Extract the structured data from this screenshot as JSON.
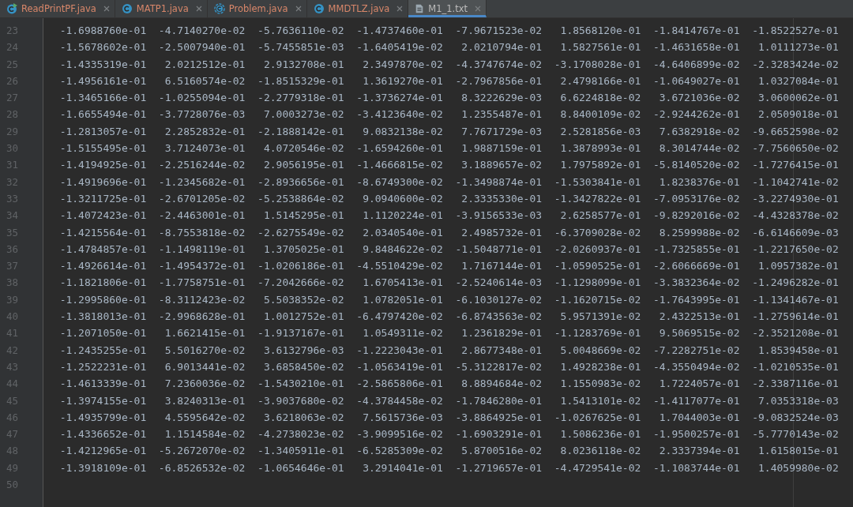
{
  "tabs": [
    {
      "label": "ReadPrintPF.java",
      "kind": "runnable-class",
      "color": "#d9876a",
      "selected": false
    },
    {
      "label": "MATP1.java",
      "kind": "class",
      "color": "#d9876a",
      "selected": false
    },
    {
      "label": "Problem.java",
      "kind": "abstract-class",
      "color": "#d9876a",
      "selected": false
    },
    {
      "label": "MMDTLZ.java",
      "kind": "class",
      "color": "#d9876a",
      "selected": false
    },
    {
      "label": "M1_1.txt",
      "kind": "text",
      "color": "#bbbbbb",
      "selected": true
    }
  ],
  "lines": [
    {
      "number": "23",
      "values": [
        "-1.6988760e-01",
        "-4.7140270e-02",
        "-5.7636110e-02",
        "-1.4737460e-01",
        "-7.9671523e-02",
        "1.8568120e-01",
        "-1.8414767e-01",
        "-1.8522527e-01"
      ]
    },
    {
      "number": "24",
      "values": [
        "-1.5678602e-01",
        "-2.5007940e-01",
        "-5.7455851e-03",
        "-1.6405419e-02",
        "2.0210794e-01",
        "1.5827561e-01",
        "-1.4631658e-01",
        "1.0111273e-01"
      ]
    },
    {
      "number": "25",
      "values": [
        "-1.4335319e-01",
        "2.0212512e-01",
        "2.9132708e-01",
        "2.3497870e-02",
        "-4.3747674e-02",
        "-3.1708028e-01",
        "-4.6406899e-02",
        "-2.3283424e-02"
      ]
    },
    {
      "number": "26",
      "values": [
        "-1.4956161e-01",
        "6.5160574e-02",
        "-1.8515329e-01",
        "1.3619270e-01",
        "-2.7967856e-01",
        "2.4798166e-01",
        "-1.0649027e-01",
        "1.0327084e-01"
      ]
    },
    {
      "number": "27",
      "values": [
        "-1.3465166e-01",
        "-1.0255094e-01",
        "-2.2779318e-01",
        "-1.3736274e-01",
        "8.3222629e-03",
        "6.6224818e-02",
        "3.6721036e-02",
        "3.0600062e-01"
      ]
    },
    {
      "number": "28",
      "values": [
        "-1.6655494e-01",
        "-3.7728076e-03",
        "7.0003273e-02",
        "-3.4123640e-02",
        "1.2355487e-01",
        "8.8400109e-02",
        "-2.9244262e-01",
        "2.0509018e-01"
      ]
    },
    {
      "number": "29",
      "values": [
        "-1.2813057e-01",
        "2.2852832e-01",
        "-2.1888142e-01",
        "9.0832138e-02",
        "7.7671729e-03",
        "2.5281856e-03",
        "7.6382918e-02",
        "-9.6652598e-02"
      ]
    },
    {
      "number": "30",
      "values": [
        "-1.5155495e-01",
        "3.7124073e-01",
        "4.0720546e-02",
        "-1.6594260e-01",
        "1.9887159e-01",
        "1.3878993e-01",
        "8.3014744e-02",
        "-7.7560650e-02"
      ]
    },
    {
      "number": "31",
      "values": [
        "-1.4194925e-01",
        "-2.2516244e-02",
        "2.9056195e-01",
        "-1.4666815e-02",
        "3.1889657e-02",
        "1.7975892e-01",
        "-5.8140520e-02",
        "-1.7276415e-01"
      ]
    },
    {
      "number": "32",
      "values": [
        "-1.4919696e-01",
        "-1.2345682e-01",
        "-2.8936656e-01",
        "-8.6749300e-02",
        "-1.3498874e-01",
        "-1.5303841e-01",
        "1.8238376e-01",
        "-1.1042741e-02"
      ]
    },
    {
      "number": "33",
      "values": [
        "-1.3211725e-01",
        "-2.6701205e-02",
        "-5.2538864e-02",
        "9.0940600e-02",
        "2.3335330e-01",
        "-1.3427822e-01",
        "-7.0953176e-02",
        "-3.2274930e-01"
      ]
    },
    {
      "number": "34",
      "values": [
        "-1.4072423e-01",
        "-2.4463001e-01",
        "1.5145295e-01",
        "1.1120224e-01",
        "-3.9156533e-03",
        "2.6258577e-01",
        "-9.8292016e-02",
        "-4.4328378e-02"
      ]
    },
    {
      "number": "35",
      "values": [
        "-1.4215564e-01",
        "-8.7553818e-02",
        "-2.6275549e-02",
        "2.0340540e-01",
        "2.4985732e-01",
        "-6.3709028e-02",
        "8.2599988e-02",
        "-6.6146609e-03"
      ]
    },
    {
      "number": "36",
      "values": [
        "-1.4784857e-01",
        "-1.1498119e-01",
        "1.3705025e-01",
        "9.8484622e-02",
        "-1.5048771e-01",
        "-2.0260937e-01",
        "-1.7325855e-01",
        "-1.2217650e-02"
      ]
    },
    {
      "number": "37",
      "values": [
        "-1.4926614e-01",
        "-1.4954372e-01",
        "-1.0206186e-01",
        "-4.5510429e-02",
        "1.7167144e-01",
        "-1.0590525e-01",
        "-2.6066669e-01",
        "1.0957382e-01"
      ]
    },
    {
      "number": "38",
      "values": [
        "-1.1821806e-01",
        "-1.7758751e-01",
        "-7.2042666e-02",
        "1.6705413e-01",
        "-2.5240614e-03",
        "-1.1298099e-01",
        "-3.3832364e-02",
        "-1.2496282e-01"
      ]
    },
    {
      "number": "39",
      "values": [
        "-1.2995860e-01",
        "-8.3112423e-02",
        "5.5038352e-02",
        "1.0782051e-01",
        "-6.1030127e-02",
        "-1.1620715e-02",
        "-1.7643995e-01",
        "-1.1341467e-01"
      ]
    },
    {
      "number": "40",
      "values": [
        "-1.3818013e-01",
        "-2.9968628e-01",
        "1.0012752e-01",
        "-6.4797420e-02",
        "-6.8743563e-02",
        "5.9571391e-02",
        "2.4322513e-01",
        "-1.2759614e-01"
      ]
    },
    {
      "number": "41",
      "values": [
        "-1.2071050e-01",
        "1.6621415e-01",
        "-1.9137167e-01",
        "1.0549311e-02",
        "1.2361829e-01",
        "-1.1283769e-01",
        "9.5069515e-02",
        "-2.3521208e-01"
      ]
    },
    {
      "number": "42",
      "values": [
        "-1.2435255e-01",
        "5.5016270e-02",
        "3.6132796e-03",
        "-1.2223043e-01",
        "2.8677348e-01",
        "5.0048669e-02",
        "-7.2282751e-02",
        "1.8539458e-01"
      ]
    },
    {
      "number": "43",
      "values": [
        "-1.2522231e-01",
        "6.9013441e-02",
        "3.6858450e-02",
        "-1.0563419e-01",
        "-5.3122817e-02",
        "1.4928238e-01",
        "-4.3550494e-02",
        "-1.0210535e-01"
      ]
    },
    {
      "number": "44",
      "values": [
        "-1.4613339e-01",
        "7.2360036e-02",
        "-1.5430210e-01",
        "-2.5865806e-01",
        "8.8894684e-02",
        "1.1550983e-02",
        "1.7224057e-01",
        "-2.3387116e-01"
      ]
    },
    {
      "number": "45",
      "values": [
        "-1.3974155e-01",
        "3.8240313e-01",
        "-3.9037680e-02",
        "-4.3784458e-02",
        "-1.7846280e-01",
        "1.5413101e-02",
        "-1.4117077e-01",
        "7.0353318e-03"
      ]
    },
    {
      "number": "46",
      "values": [
        "-1.4935799e-01",
        "4.5595642e-02",
        "3.6218063e-02",
        "7.5615736e-03",
        "-3.8864925e-01",
        "-1.0267625e-01",
        "1.7044003e-01",
        "-9.0832524e-03"
      ]
    },
    {
      "number": "47",
      "values": [
        "-1.4336652e-01",
        "1.1514584e-02",
        "-4.2738023e-02",
        "-3.9099516e-02",
        "-1.6903291e-01",
        "1.5086236e-01",
        "-1.9500257e-01",
        "-5.7770143e-02"
      ]
    },
    {
      "number": "48",
      "values": [
        "-1.4212965e-01",
        "-5.2672070e-02",
        "-1.3405911e-01",
        "-6.5285309e-02",
        "5.8700516e-02",
        "8.0236118e-02",
        "2.3337394e-01",
        "1.6158015e-01"
      ]
    },
    {
      "number": "49",
      "values": [
        "-1.3918109e-01",
        "-6.8526532e-02",
        "-1.0654646e-01",
        "3.2914041e-01",
        "-1.2719657e-01",
        "-4.4729541e-02",
        "-1.1083744e-01",
        "1.4059980e-02"
      ]
    },
    {
      "number": "50"
    }
  ]
}
